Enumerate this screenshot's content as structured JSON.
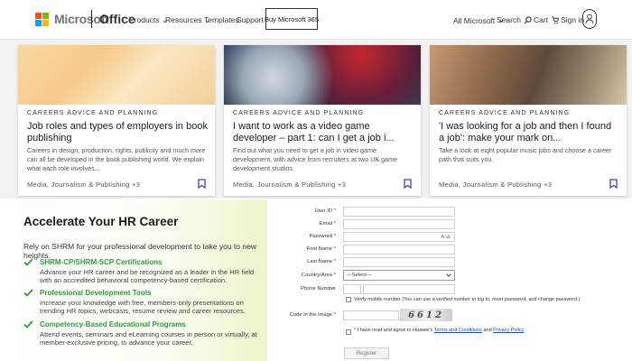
{
  "header": {
    "brand": "Microsoft",
    "product": "Office",
    "nav": [
      {
        "label": "Products",
        "chevron": true
      },
      {
        "label": "Resources",
        "chevron": true
      },
      {
        "label": "Templates",
        "chevron": false
      },
      {
        "label": "Support",
        "chevron": false
      }
    ],
    "buy_label": "Buy Microsoft 365",
    "all_microsoft": "All Microsoft",
    "search": "Search",
    "cart": "Cart",
    "signin": "Sign in"
  },
  "cards": [
    {
      "category": "CAREERS ADVICE AND PLANNING",
      "title": "Job roles and types of employers in book publishing",
      "description": "Careers in design, production, rights, publicity and much more can all be developed in the book publishing world. We explain what each role involves...",
      "footer": "Media, Journalism & Publishing +3"
    },
    {
      "category": "CAREERS ADVICE AND PLANNING",
      "title": "I want to work as a video game developer – part 1: can I get a job i...",
      "description": "Find out what you need to get a job in video game development, with advice from recruiters at two UK game development studios.",
      "footer": "Media, Journalism & Publishing +3"
    },
    {
      "category": "CAREERS ADVICE AND PLANNING",
      "title": "'I was looking for a job and then I found a job': make your mark on...",
      "description": "Take a look at eight popular music jobs and choose a career path that suits you.",
      "footer": "Media, Journalism & Publishing +3"
    }
  ],
  "ad": {
    "title": "Accelerate Your HR Career",
    "subtitle": "Rely on SHRM for your professional development to take you to new heights.",
    "items": [
      {
        "heading": "SHRM-CP/SHRM-SCP Certifications",
        "text": "Advance your HR career and be recognized as a leader in the HR field with an accredited behavioral competency-based certification."
      },
      {
        "heading": "Professional Development Tools",
        "text": "Increase your knowledge with free, members-only presentations on trending HR topics, webcasts, resume review and career resources."
      },
      {
        "heading": "Competency-Based Educational Programs",
        "text": "Attend events, seminars and eLearning courses in person or virtually, at member-exclusive pricing, to advance your career."
      }
    ],
    "accent": "#2f9a3c"
  },
  "form": {
    "user_id_label": "User ID",
    "email_label": "Email",
    "password_label": "Password",
    "password_toggle": "Ʌⁿ∆",
    "first_name_label": "First Name",
    "last_name_label": "Last Name",
    "country_label": "Country/Area",
    "country_value": "---Select---",
    "phone_label": "Phone Number",
    "verify_text": "Verify mobile number (You can use a verified number to log in, reset password, and change password.)",
    "code_label": "Code in the Image",
    "captcha_text": "6612",
    "agree_prefix": "I have read and agree to Huawei's ",
    "terms_link": "Terms and Conditions",
    "and_text": " and ",
    "privacy_link": "Privacy Policy",
    "register_label": "Register"
  }
}
